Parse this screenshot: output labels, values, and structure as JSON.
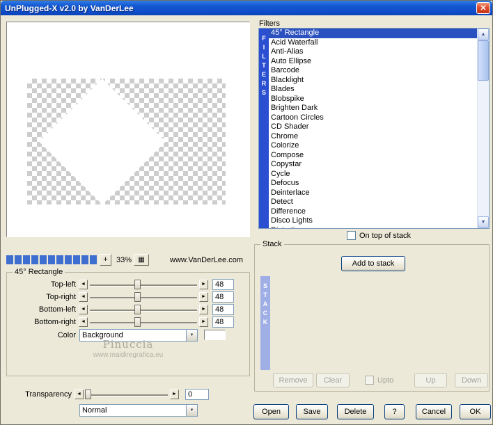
{
  "window": {
    "title": "UnPlugged-X v2.0 by VanDerLee"
  },
  "icons": {
    "close": "✕",
    "up": "▲",
    "down": "▼",
    "left": "◄",
    "right": "►",
    "dropdown": "▼",
    "plus": "+",
    "grid": "▦"
  },
  "colors": {
    "titlebar_top": "#2F7CE8",
    "titlebar_bottom": "#0B44B8",
    "selection": "#2B50C0",
    "filters_bar": "#2A4FD0",
    "stack_bar": "#9FAEE5",
    "progress": "#3E6FD0"
  },
  "preview": {
    "zoom_level": "33%",
    "website": "www.VanDerLee.com"
  },
  "params": {
    "group_title": "45° Rectangle",
    "sliders": [
      {
        "label": "Top-left",
        "value": "48"
      },
      {
        "label": "Top-right",
        "value": "48"
      },
      {
        "label": "Bottom-left",
        "value": "48"
      },
      {
        "label": "Bottom-right",
        "value": "48"
      }
    ],
    "color_label": "Color",
    "color_value": "Background",
    "watermark_name": "Pinuccia",
    "watermark_site": "www.maidiregrafica.eu",
    "transparency_label": "Transparency",
    "transparency_value": "0",
    "blend_mode": "Normal"
  },
  "filters": {
    "label": "Filters",
    "vertical_label": "FILTERS",
    "selected_index": 0,
    "items": [
      "45° Rectangle",
      "Acid Waterfall",
      "Anti-Alias",
      "Auto Ellipse",
      "Barcode",
      "Blacklight",
      "Blades",
      "Blobspike",
      "Brighten Dark",
      "Cartoon Circles",
      "CD Shader",
      "Chrome",
      "Colorize",
      "Compose",
      "Copystar",
      "Cycle",
      "Defocus",
      "Deinterlace",
      "Detect",
      "Difference",
      "Disco Lights",
      "Distortion"
    ],
    "on_top_label": "On top of stack"
  },
  "stack": {
    "group_title": "Stack",
    "vertical_label": "STACK",
    "add_button": "Add to stack",
    "remove_button": "Remove",
    "clear_button": "Clear",
    "upto_label": "Upto",
    "up_button": "Up",
    "down_button": "Down"
  },
  "footer": {
    "open": "Open",
    "save": "Save",
    "delete": "Delete",
    "help": "?",
    "cancel": "Cancel",
    "ok": "OK"
  }
}
